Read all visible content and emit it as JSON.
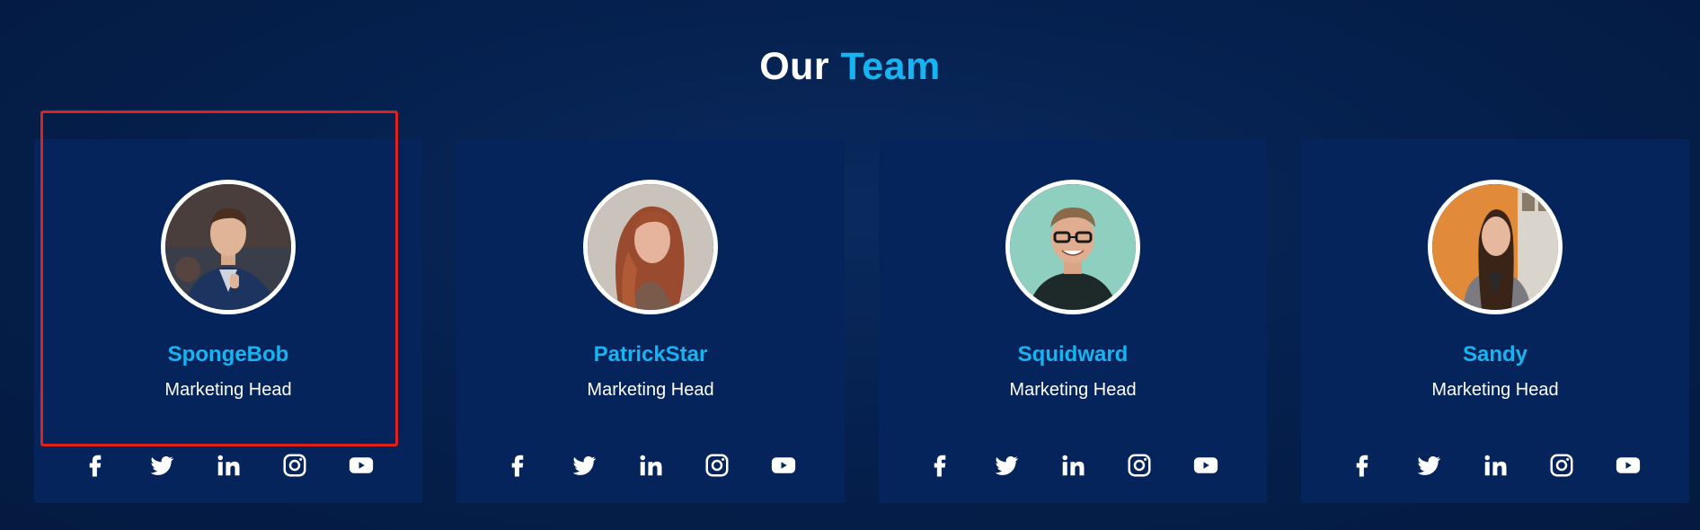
{
  "section": {
    "title_plain": "Our ",
    "title_accent": "Team",
    "accent_color": "#16b4f0"
  },
  "members": [
    {
      "name": "SpongeBob",
      "role": "Marketing Head",
      "photo_icon": "man-in-suit-portrait"
    },
    {
      "name": "PatrickStar",
      "role": "Marketing Head",
      "photo_icon": "woman-red-hair-portrait"
    },
    {
      "name": "Squidward",
      "role": "Marketing Head",
      "photo_icon": "man-glasses-portrait"
    },
    {
      "name": "Sandy",
      "role": "Marketing Head",
      "photo_icon": "woman-gray-blazer-portrait"
    }
  ],
  "social_icons": [
    "facebook-icon",
    "twitter-icon",
    "linkedin-icon",
    "instagram-icon",
    "youtube-icon"
  ],
  "colors": {
    "background": "#041a40",
    "card": "#06245c",
    "highlight_border": "#e0201d"
  }
}
